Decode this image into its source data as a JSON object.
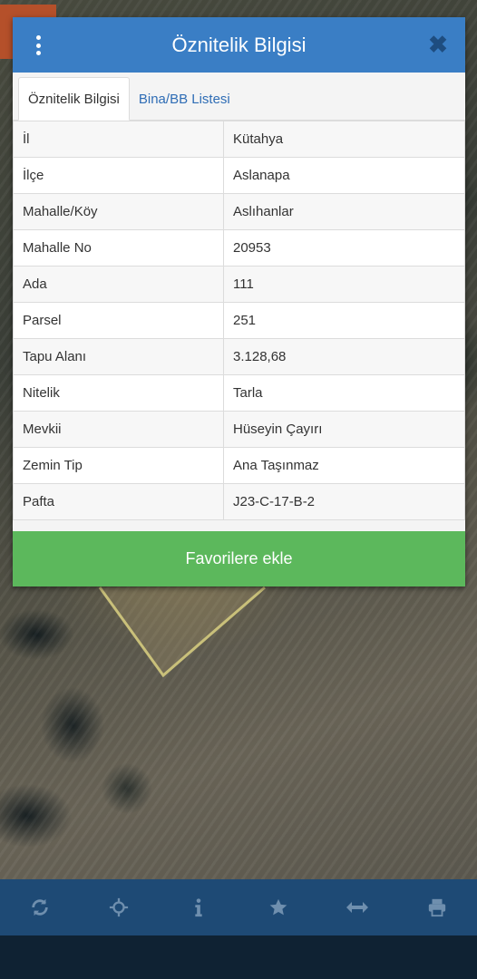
{
  "dialog": {
    "title": "Öznitelik Bilgisi",
    "close_glyph": "✖"
  },
  "tabs": [
    {
      "label": "Öznitelik Bilgisi",
      "active": true
    },
    {
      "label": "Bina/BB Listesi",
      "active": false
    }
  ],
  "attributes": [
    {
      "key": "İl",
      "value": "Kütahya"
    },
    {
      "key": "İlçe",
      "value": "Aslanapa"
    },
    {
      "key": "Mahalle/Köy",
      "value": "Aslıhanlar"
    },
    {
      "key": "Mahalle No",
      "value": "20953"
    },
    {
      "key": "Ada",
      "value": "111"
    },
    {
      "key": "Parsel",
      "value": "251"
    },
    {
      "key": "Tapu Alanı",
      "value": "3.128,68"
    },
    {
      "key": "Nitelik",
      "value": "Tarla"
    },
    {
      "key": "Mevkii",
      "value": "Hüseyin Çayırı"
    },
    {
      "key": "Zemin Tip",
      "value": "Ana Taşınmaz"
    },
    {
      "key": "Pafta",
      "value": "J23-C-17-B-2"
    }
  ],
  "favorite_button": {
    "label": "Favorilere ekle"
  },
  "toolbar": {
    "icons": [
      "refresh-icon",
      "crosshair-icon",
      "info-icon",
      "star-icon",
      "measure-icon",
      "print-icon"
    ]
  },
  "colors": {
    "header": "#3a7ec5",
    "favorite_button": "#5cb85c",
    "toolbar": "#1e4a75",
    "toolbar_icon": "#6f8fae",
    "parcel_outline": "#c9c07a"
  }
}
